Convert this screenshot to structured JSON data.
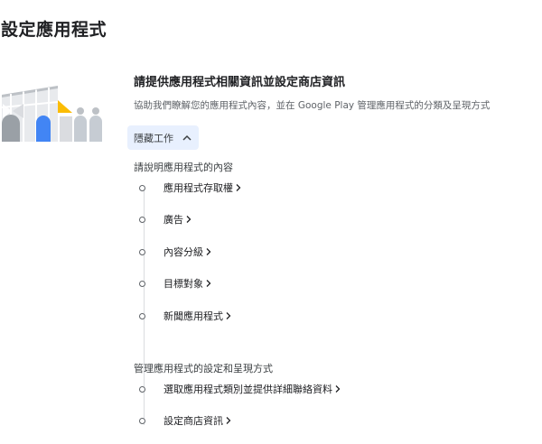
{
  "page": {
    "title": "設定應用程式"
  },
  "setup": {
    "title": "請提供應用程式相關資訊並設定商店資訊",
    "subtitle": "協助我們瞭解您的應用程式內容，並在 Google Play 管理應用程式的分類及呈現方式",
    "toggle_label": "隱藏工作",
    "toggle_icon": "chevron-up-icon"
  },
  "groups": [
    {
      "heading": "請說明應用程式的內容",
      "tasks": [
        {
          "label": "應用程式存取權"
        },
        {
          "label": "廣告"
        },
        {
          "label": "內容分級"
        },
        {
          "label": "目標對象"
        },
        {
          "label": "新聞應用程式"
        }
      ]
    },
    {
      "heading": "管理應用程式的設定和呈現方式",
      "tasks": [
        {
          "label": "選取應用程式類別並提供詳細聯絡資料"
        },
        {
          "label": "設定商店資訊"
        }
      ]
    }
  ],
  "colors": {
    "accent_blue": "#4285f4",
    "accent_yellow": "#fbbc04",
    "illustration_gray": "#c6ccd3",
    "toggle_background": "#e8f0fe"
  }
}
